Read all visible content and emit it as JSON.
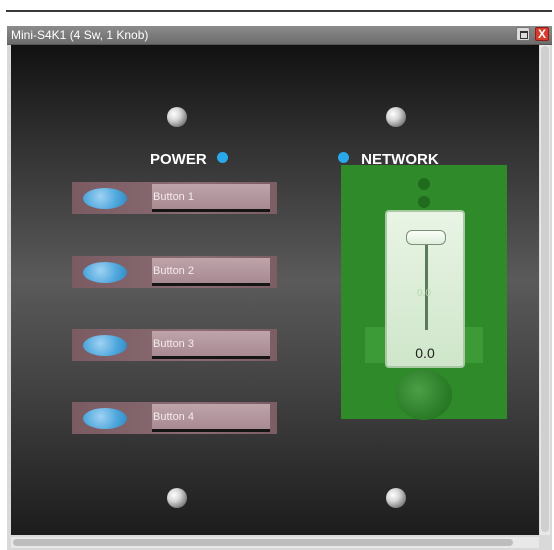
{
  "window": {
    "title": "Mini-S4K1 (4 Sw, 1 Knob)",
    "close_glyph": "X"
  },
  "panel": {
    "power_label": "POWER",
    "network_label": "NETWORK",
    "led_color": "#29a8ea",
    "buttons": [
      {
        "label": "Button 1"
      },
      {
        "label": "Button 2"
      },
      {
        "label": "Button 3"
      },
      {
        "label": "Button 4"
      }
    ],
    "knob": {
      "value": "0.0",
      "faint_label": "0.0"
    }
  }
}
